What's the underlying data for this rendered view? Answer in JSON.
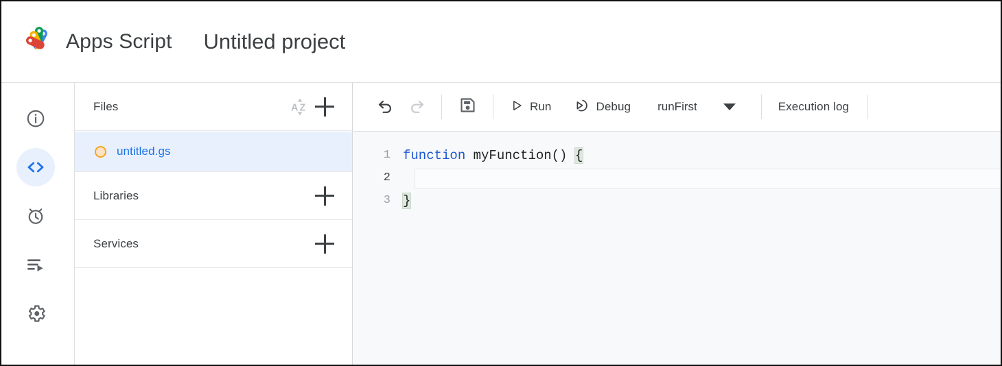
{
  "header": {
    "logo_icon": "apps-script-logo",
    "app_name": "Apps Script",
    "project_name": "Untitled project"
  },
  "rail": {
    "items": [
      {
        "icon": "info-circle-icon",
        "name": "overview",
        "active": false
      },
      {
        "icon": "code-brackets-icon",
        "name": "editor",
        "active": true
      },
      {
        "icon": "alarm-clock-icon",
        "name": "triggers",
        "active": false
      },
      {
        "icon": "executions-list-play-icon",
        "name": "executions",
        "active": false
      },
      {
        "icon": "gear-icon",
        "name": "project-settings",
        "active": false
      }
    ]
  },
  "files_panel": {
    "files_header": {
      "label": "Files",
      "sort_icon": "az-sort-icon",
      "add_icon": "plus-icon"
    },
    "file_items": [
      {
        "name": "untitled.gs",
        "status_icon": "orange-circle-icon",
        "selected": true
      }
    ],
    "libraries": {
      "label": "Libraries",
      "add_icon": "plus-icon"
    },
    "services": {
      "label": "Services",
      "add_icon": "plus-icon"
    }
  },
  "toolbar": {
    "undo_icon": "undo-arrow-icon",
    "redo_icon": "redo-arrow-icon",
    "save_icon": "floppy-disk-save-icon",
    "run_label": "Run",
    "run_icon": "play-triangle-icon",
    "debug_label": "Debug",
    "debug_icon": "debug-step-icon",
    "function_select_value": "runFirst",
    "function_select_caret": "chevron-down-icon",
    "execution_log_label": "Execution log"
  },
  "editor": {
    "lines": [
      {
        "number": "1",
        "active": false,
        "segments": [
          {
            "text": "function ",
            "style": "keyword"
          },
          {
            "text": "myFunction() ",
            "style": "plain"
          },
          {
            "text": "{",
            "style": "bracket-match"
          }
        ]
      },
      {
        "number": "2",
        "active": true,
        "segments": [
          {
            "text": "  ",
            "style": "plain"
          }
        ]
      },
      {
        "number": "3",
        "active": false,
        "segments": [
          {
            "text": "}",
            "style": "bracket-match"
          }
        ]
      }
    ]
  },
  "colors": {
    "accent_blue": "#1a73e8",
    "keyword_blue": "#1a56d6",
    "selected_row_bg": "#e8f0fe",
    "editor_bg": "#f8f9fa",
    "text_primary": "#3c4043",
    "file_dot_border": "#f5a623",
    "bracket_match_bg": "#dfe8df"
  }
}
